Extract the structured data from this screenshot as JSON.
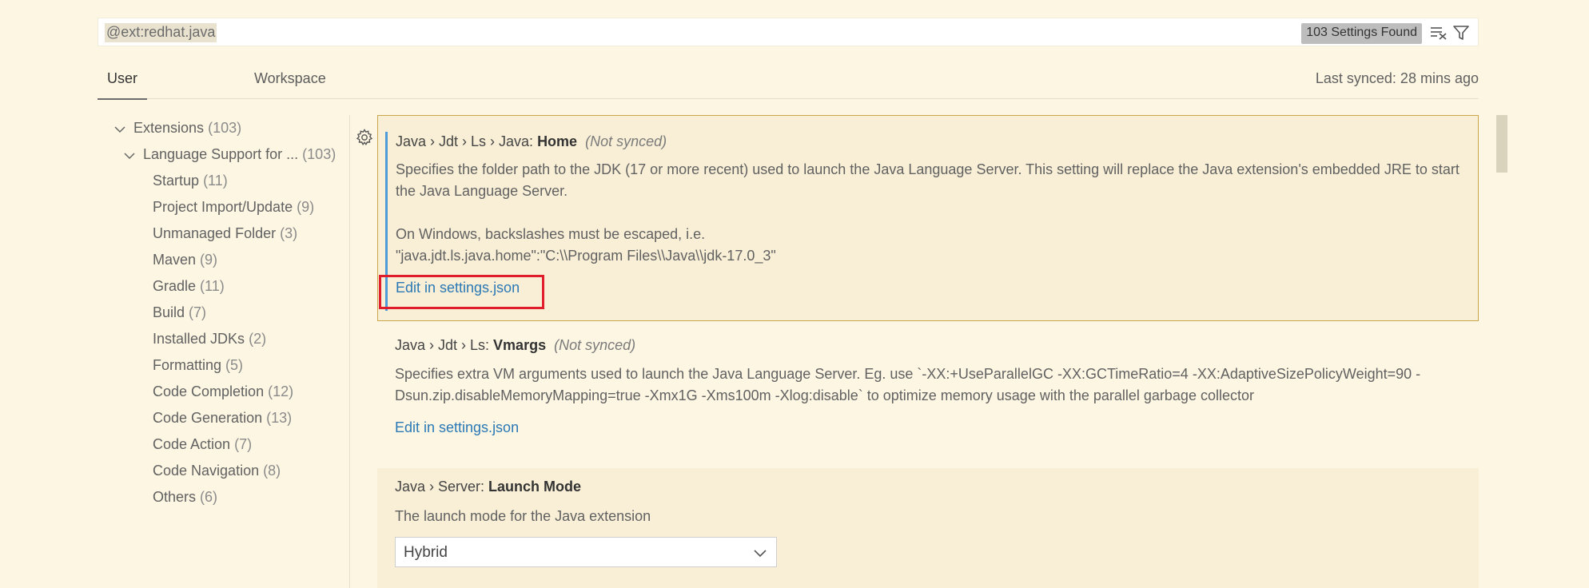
{
  "search": {
    "value": "@ext:redhat.java",
    "results_badge": "103 Settings Found"
  },
  "tabs": [
    {
      "label": "User"
    },
    {
      "label": "Workspace"
    }
  ],
  "sync_status": "Last synced: 28 mins ago",
  "tree": [
    {
      "label": "Extensions",
      "count": "(103)"
    },
    {
      "label": "Language Support for ...",
      "count": "(103)"
    },
    {
      "label": "Startup",
      "count": "(11)"
    },
    {
      "label": "Project Import/Update",
      "count": "(9)"
    },
    {
      "label": "Unmanaged Folder",
      "count": "(3)"
    },
    {
      "label": "Maven",
      "count": "(9)"
    },
    {
      "label": "Gradle",
      "count": "(11)"
    },
    {
      "label": "Build",
      "count": "(7)"
    },
    {
      "label": "Installed JDKs",
      "count": "(2)"
    },
    {
      "label": "Formatting",
      "count": "(5)"
    },
    {
      "label": "Code Completion",
      "count": "(12)"
    },
    {
      "label": "Code Generation",
      "count": "(13)"
    },
    {
      "label": "Code Action",
      "count": "(7)"
    },
    {
      "label": "Code Navigation",
      "count": "(8)"
    },
    {
      "label": "Others",
      "count": "(6)"
    }
  ],
  "settings": {
    "home": {
      "prefix": "Java › Jdt › Ls › Java: ",
      "name": "Home",
      "sync": "(Not synced)",
      "desc1": "Specifies the folder path to the JDK (17 or more recent) used to launch the Java Language Server. This setting will replace the Java extension's embedded JRE to start the Java Language Server.",
      "desc2": "On Windows, backslashes must be escaped, i.e.",
      "desc3": "\"java.jdt.ls.java.home\":\"C:\\\\Program Files\\\\Java\\\\jdk-17.0_3\"",
      "link": "Edit in settings.json"
    },
    "vmargs": {
      "prefix": "Java › Jdt › Ls: ",
      "name": "Vmargs",
      "sync": "(Not synced)",
      "desc": "Specifies extra VM arguments used to launch the Java Language Server. Eg. use `-XX:+UseParallelGC -XX:GCTimeRatio=4 -XX:AdaptiveSizePolicyWeight=90 -Dsun.zip.disableMemoryMapping=true -Xmx1G -Xms100m -Xlog:disable` to optimize memory usage with the parallel garbage collector",
      "link": "Edit in settings.json"
    },
    "launch_mode": {
      "prefix": "Java › Server: ",
      "name": "Launch Mode",
      "desc": "The launch mode for the Java extension",
      "selected": "Hybrid"
    }
  }
}
